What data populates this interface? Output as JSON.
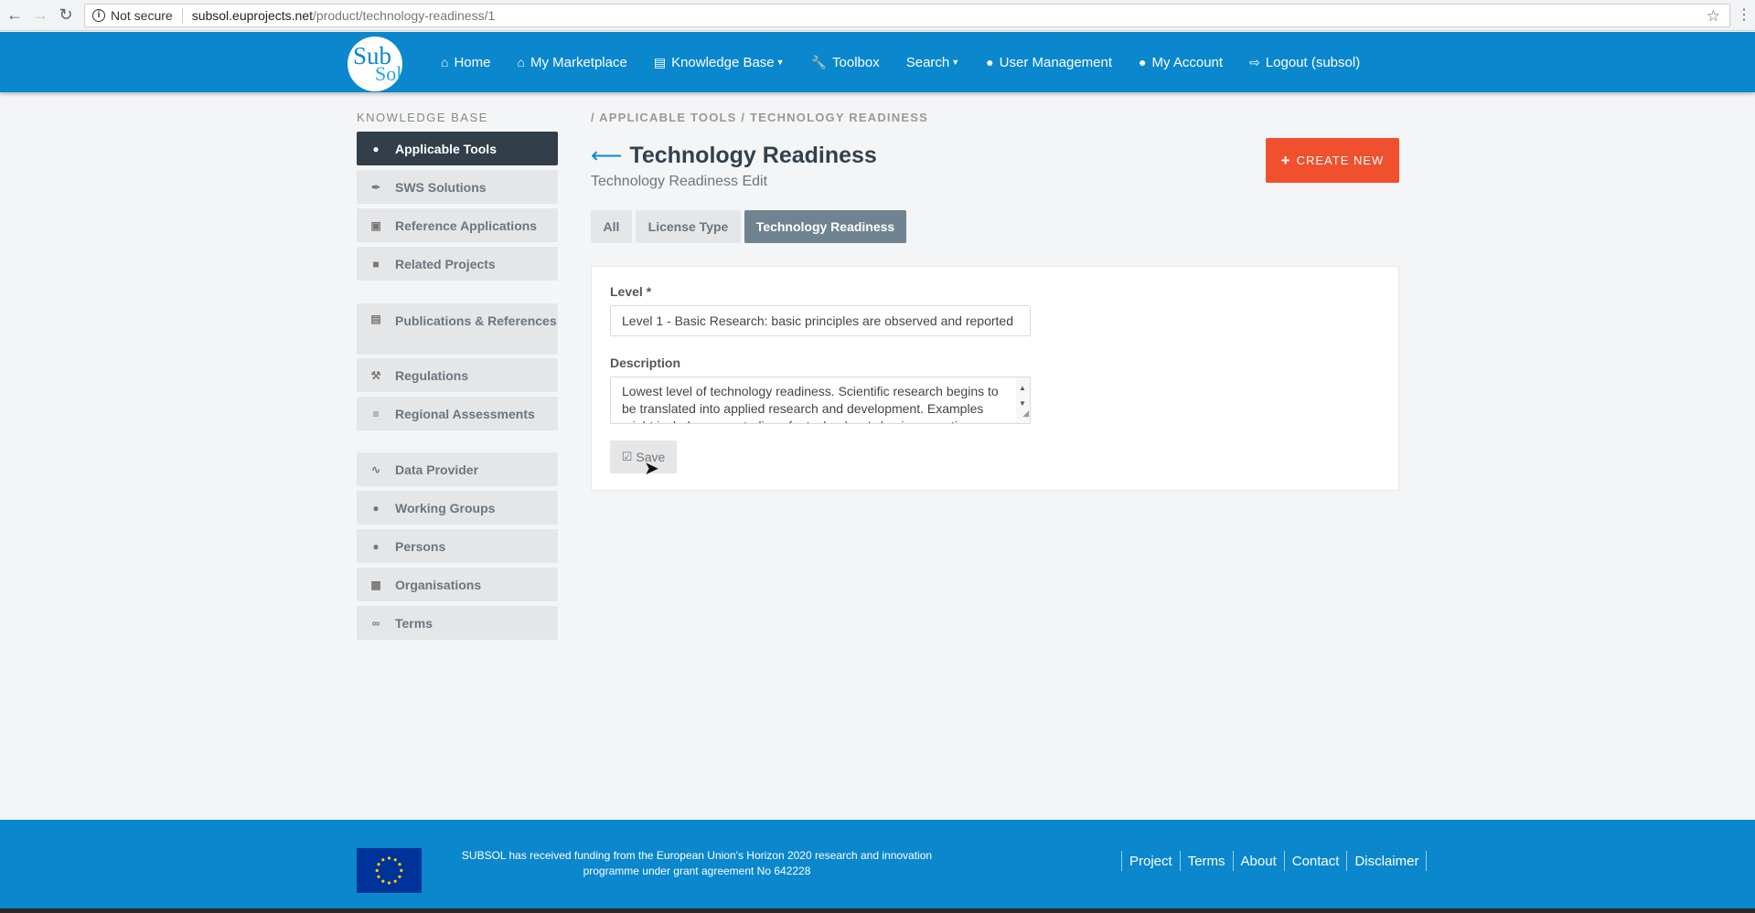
{
  "browser": {
    "security_label": "Not secure",
    "url_host": "subsol.euprojects.net",
    "url_path": "/product/technology-readiness/1"
  },
  "header": {
    "logo_top": "Sub",
    "logo_bottom": "Sol",
    "nav": [
      {
        "label": "Home",
        "icon": "home-icon"
      },
      {
        "label": "My Marketplace",
        "icon": "store-icon"
      },
      {
        "label": "Knowledge Base",
        "icon": "table-icon"
      },
      {
        "label": "Toolbox",
        "icon": "wrench-icon"
      },
      {
        "label": "Search",
        "icon": ""
      },
      {
        "label": "User Management",
        "icon": "users-icon"
      },
      {
        "label": "My Account",
        "icon": "user-icon"
      },
      {
        "label": "Logout (subsol)",
        "icon": "logout-icon"
      }
    ]
  },
  "sidebar": {
    "title": "KNOWLEDGE BASE",
    "items": [
      {
        "label": "Applicable Tools",
        "icon": "drop-icon"
      },
      {
        "label": "SWS Solutions",
        "icon": "eyedropper-icon"
      },
      {
        "label": "Reference Applications",
        "icon": "image-icon"
      },
      {
        "label": "Related Projects",
        "icon": "folder-icon"
      },
      {
        "label": "Publications & References",
        "icon": "file-icon"
      },
      {
        "label": "Regulations",
        "icon": "gavel-icon"
      },
      {
        "label": "Regional Assessments",
        "icon": "lines-icon"
      },
      {
        "label": "Data Provider",
        "icon": "rss-icon"
      },
      {
        "label": "Working Groups",
        "icon": "users-icon"
      },
      {
        "label": "Persons",
        "icon": "user-icon"
      },
      {
        "label": "Organisations",
        "icon": "briefcase-icon"
      },
      {
        "label": "Terms",
        "icon": "paperclip-icon"
      }
    ]
  },
  "main": {
    "breadcrumb": "/ APPLICABLE TOOLS / TECHNOLOGY READINESS",
    "title": "Technology Readiness",
    "subtitle": "Technology Readiness Edit",
    "create_label": "CREATE NEW",
    "tabs": [
      {
        "label": "All"
      },
      {
        "label": "License Type"
      },
      {
        "label": "Technology Readiness"
      }
    ],
    "form": {
      "level_label": "Level *",
      "level_value": "Level 1 - Basic Research: basic principles are observed and reported",
      "description_label": "Description",
      "description_value": "Lowest level of technology readiness. Scientific research begins to be translated into applied research and development. Examples might include paper studies of a technology's basic properties.",
      "save_label": "Save"
    }
  },
  "footer": {
    "funding_text": "SUBSOL has received funding from the European Union's Horizon 2020 research and innovation programme under grant agreement No 642228",
    "links": [
      "Project",
      "Terms",
      "About",
      "Contact",
      "Disclaimer"
    ]
  },
  "colors": {
    "brand_blue": "#0a87cd",
    "accent_orange": "#f0502e",
    "sidebar_active": "#323e4a",
    "tab_active": "#6f8391"
  }
}
